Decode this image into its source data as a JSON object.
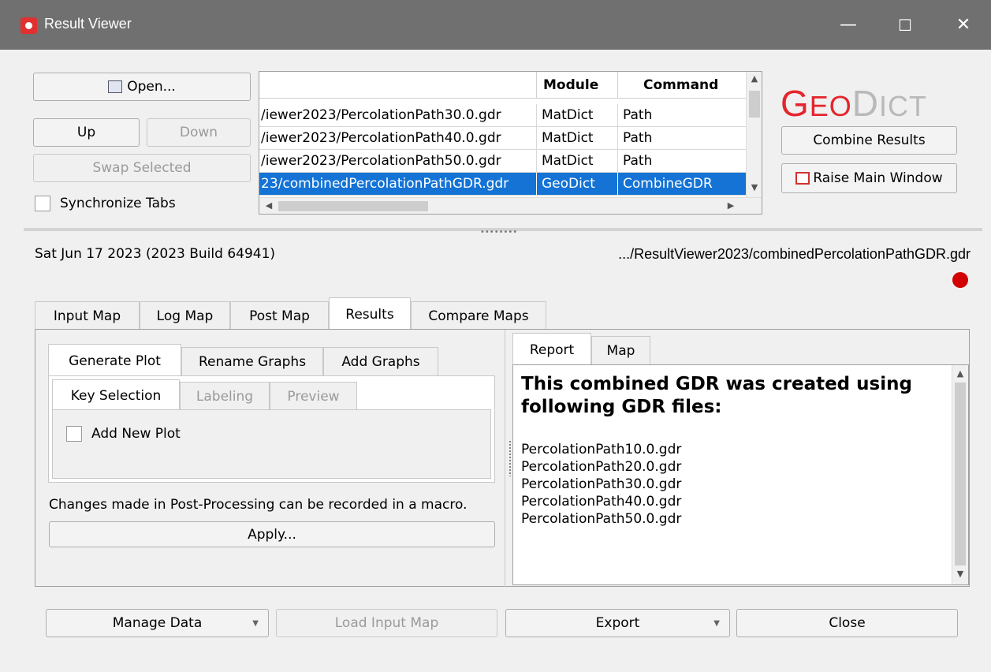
{
  "window": {
    "title": "Result Viewer",
    "controls": {
      "minimize": "—",
      "maximize": "☐",
      "close": "✕"
    }
  },
  "left_controls": {
    "open_label": "Open...",
    "up_label": "Up",
    "down_label": "Down",
    "swap_label": "Swap Selected",
    "sync_tabs_label": "Synchronize Tabs"
  },
  "results_table": {
    "columns": [
      "",
      "Module",
      "Command"
    ],
    "rows": [
      {
        "file": "/iewer2023/PercolationPath30.0.gdr",
        "module": "MatDict",
        "command": "Path",
        "selected": false
      },
      {
        "file": "/iewer2023/PercolationPath40.0.gdr",
        "module": "MatDict",
        "command": "Path",
        "selected": false
      },
      {
        "file": "/iewer2023/PercolationPath50.0.gdr",
        "module": "MatDict",
        "command": "Path",
        "selected": false
      },
      {
        "file": "23/combinedPercolationPathGDR.gdr",
        "module": "GeoDict",
        "command": "CombineGDR",
        "selected": true
      }
    ]
  },
  "logo": {
    "geo_first": "G",
    "geo_rest": "EO",
    "dict_first": "D",
    "dict_rest": "ICT",
    "color": "#e5252d"
  },
  "right_controls": {
    "combine_label": "Combine Results",
    "raise_label": "Raise Main Window"
  },
  "info": {
    "date_build": "Sat Jun 17 2023 (2023 Build 64941)",
    "file_path": ".../ResultViewer2023/combinedPercolationPathGDR.gdr",
    "status_color": "#d20000"
  },
  "main_tabs": [
    {
      "label": "Input Map",
      "active": false
    },
    {
      "label": "Log Map",
      "active": false
    },
    {
      "label": "Post Map",
      "active": false
    },
    {
      "label": "Results",
      "active": true
    },
    {
      "label": "Compare Maps",
      "active": false
    }
  ],
  "results_tabs": [
    {
      "label": "Generate Plot",
      "active": true
    },
    {
      "label": "Rename Graphs",
      "active": false
    },
    {
      "label": "Add Graphs",
      "active": false
    }
  ],
  "plot_tabs": [
    {
      "label": "Key Selection",
      "active": true,
      "disabled": false
    },
    {
      "label": "Labeling",
      "active": false,
      "disabled": true
    },
    {
      "label": "Preview",
      "active": false,
      "disabled": true
    }
  ],
  "plot_options": {
    "add_new_plot_label": "Add New Plot"
  },
  "macro_note": "Changes made in Post-Processing can be recorded in a macro.",
  "apply_label": "Apply...",
  "report_tabs": [
    {
      "label": "Report",
      "active": true
    },
    {
      "label": "Map",
      "active": false
    }
  ],
  "report": {
    "heading": "This combined GDR was created using following GDR files:",
    "files": [
      "PercolationPath10.0.gdr",
      "PercolationPath20.0.gdr",
      "PercolationPath30.0.gdr",
      "PercolationPath40.0.gdr",
      "PercolationPath50.0.gdr"
    ]
  },
  "bottom_bar": {
    "manage_data": "Manage Data",
    "load_input_map": "Load Input Map",
    "export": "Export",
    "close": "Close"
  }
}
